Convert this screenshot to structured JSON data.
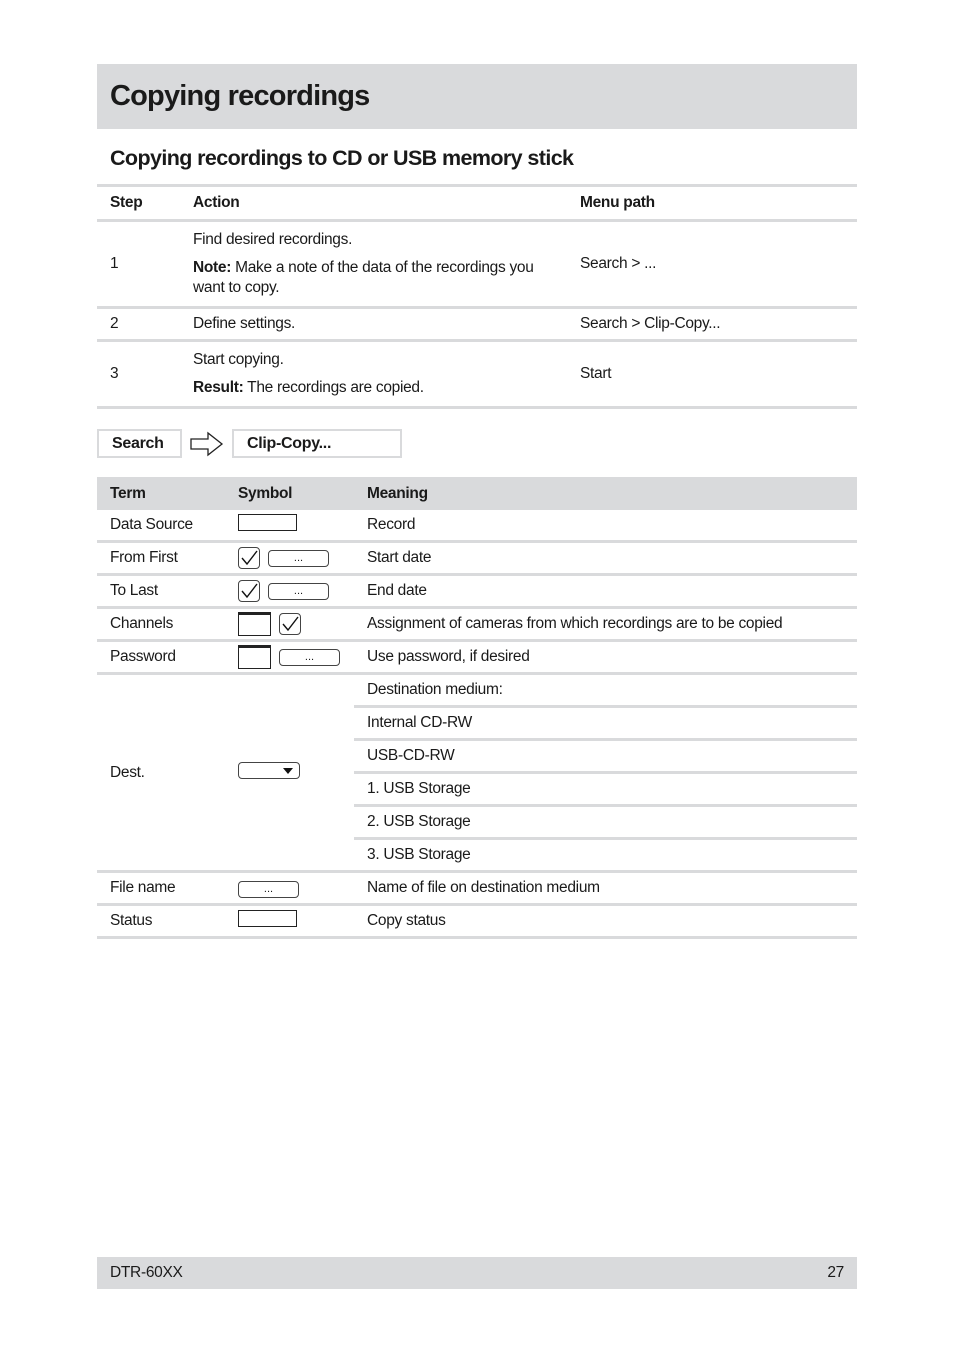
{
  "page": {
    "title": "Copying recordings",
    "subtitle": "Copying recordings to CD or USB memory stick"
  },
  "steps_table": {
    "headers": {
      "step": "Step",
      "action": "Action",
      "menu_path": "Menu path"
    },
    "rows": [
      {
        "step": "1",
        "action_main": "Find desired recordings.",
        "action_label": "Note:",
        "action_detail": " Make a note of the data of the recordings you want to copy.",
        "menu_path": "Search > ..."
      },
      {
        "step": "2",
        "action_main": "Define settings.",
        "menu_path": "Search > Clip-Copy..."
      },
      {
        "step": "3",
        "action_main": "Start copying.",
        "action_label": "Result:",
        "action_detail": " The recordings are copied.",
        "menu_path": "Start"
      }
    ]
  },
  "breadcrumb": {
    "items": [
      "Search",
      "Clip-Copy..."
    ],
    "separator_icon": "hollow-arrow-right"
  },
  "terms_table": {
    "headers": {
      "term": "Term",
      "symbol": "Symbol",
      "meaning": "Meaning"
    },
    "rows": [
      {
        "term": "Data Source",
        "symbol": "text-field",
        "meaning": "Record"
      },
      {
        "term": "From First",
        "symbol": "checkbox + ellipsis-button",
        "meaning": "Start date",
        "button_label": "..."
      },
      {
        "term": "To Last",
        "symbol": "checkbox + ellipsis-button",
        "meaning": "End date",
        "button_label": "..."
      },
      {
        "term": "Channels",
        "symbol": "field + checkbox",
        "meaning": "Assignment of cameras from which recordings are to be copied"
      },
      {
        "term": "Password",
        "symbol": "field + ellipsis-button",
        "meaning": "Use password, if desired",
        "button_label": "..."
      },
      {
        "term": "Dest.",
        "symbol": "dropdown",
        "meaning": "Destination medium:",
        "options": [
          "Internal CD-RW",
          "USB-CD-RW",
          "1. USB Storage",
          "2. USB Storage",
          "3. USB Storage"
        ]
      },
      {
        "term": "File name",
        "symbol": "ellipsis-button",
        "meaning": "Name of file on destination medium",
        "button_label": "..."
      },
      {
        "term": "Status",
        "symbol": "text-field",
        "meaning": "Copy status"
      }
    ]
  },
  "footer": {
    "model": "DTR-60XX",
    "page_number": "27"
  }
}
